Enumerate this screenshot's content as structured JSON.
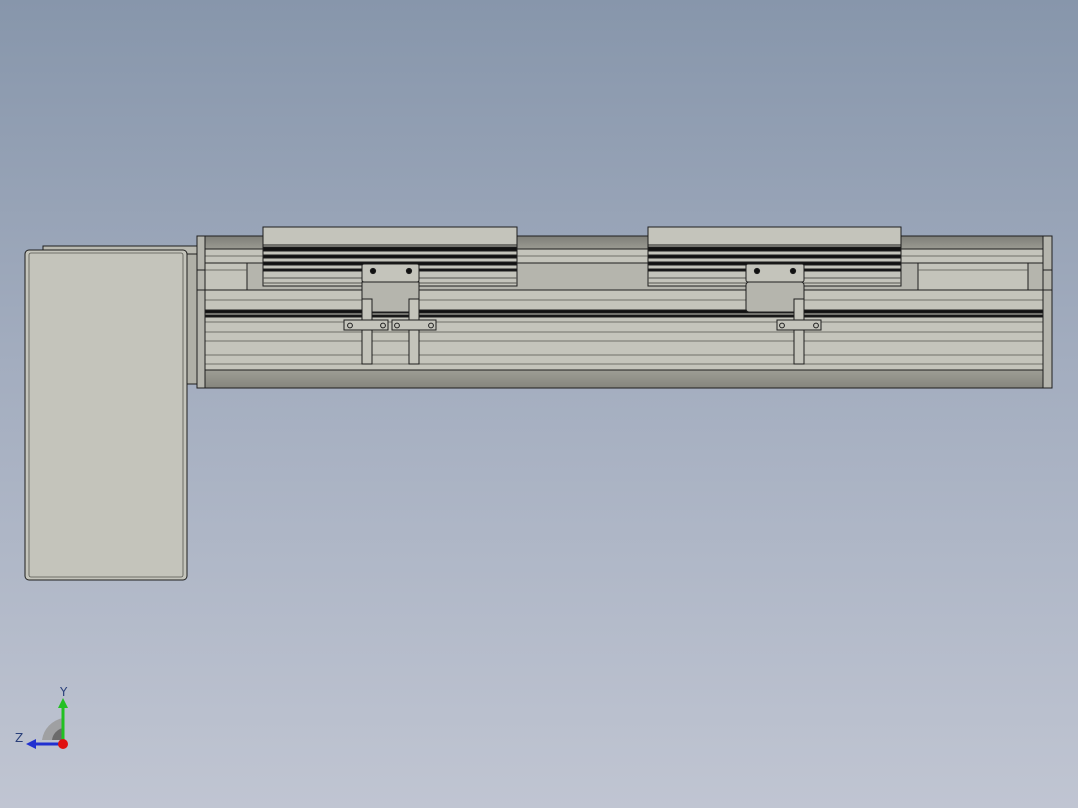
{
  "viewport": {
    "background_top": "#8796ab",
    "background_bottom": "#c0c5d2"
  },
  "model": {
    "part_color": "#c4c4bb",
    "shade_color": "#a9a99f",
    "dark_color": "#7d7d76",
    "edge_color": "#1e1e1e"
  },
  "triad": {
    "y_label": "Y",
    "z_label": "Z",
    "y_color": "#22c022",
    "z_color": "#2030d0",
    "x_color": "#e01010"
  }
}
